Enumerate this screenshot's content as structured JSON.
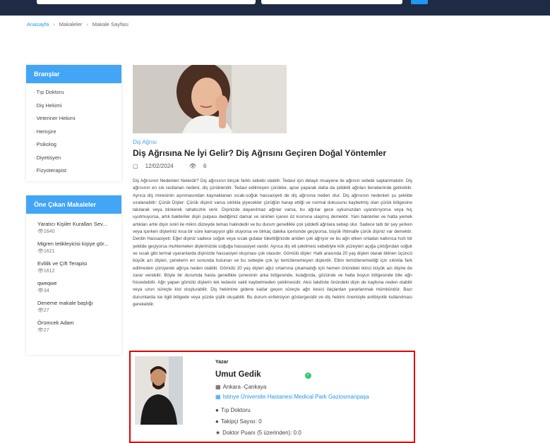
{
  "breadcrumb": {
    "home": "Anasayfa",
    "articles": "Makaleler",
    "current": "Makale Sayfası"
  },
  "branches": {
    "title": "Branşlar",
    "items": [
      "Tıp Doktoru",
      "Diş Hekimi",
      "Veteriner Hekimi",
      "Hemşire",
      "Psikolog",
      "Diyetisyen",
      "Fizyoterapist"
    ]
  },
  "featured": {
    "title": "Öne Çıkan Makaleler",
    "items": [
      {
        "title": "Yaratıcı Kişiler Kuralları Sev...",
        "views": "1640"
      },
      {
        "title": "Migren tetikleyicisi kişiye gör...",
        "views": "1621"
      },
      {
        "title": "Evlilik ve Çift Terapisi",
        "views": "1612"
      },
      {
        "title": "qweqwe",
        "views": "34"
      },
      {
        "title": "Deneme makale başlığı",
        "views": "27"
      },
      {
        "title": "Örümcek Adam",
        "views": "27"
      }
    ]
  },
  "article": {
    "category": "Diş Ağrısı",
    "title": "Diş Ağrısına Ne İyi Gelir? Diş Ağrısını Geçiren Doğal Yöntemler",
    "date": "12/02/2024",
    "views": "6",
    "body": "Diş Ağrısının Nedenleri Nelerdir? Diş ağrısının birçok farklı sebebi olabilir. Tedavi için detaylı muayene ile ağrının sebebi saptanmalıdır. Diş ağrısının en sık rastlanan nedeni, diş çürükleridir. Tedavi edilmeyen çürükler, apse yaparak daha da şiddetli ağrıları beraberinde getirebilir. Ayrıca diş minesinin aşınmasından kaynaklanan sıcak-soğuk hassasiyeti de diş ağrısına neden olur. Diş ağrısının nedenleri şu şekilde sıralanabilir: Çürük Dişler: Çürük dişiniz varsa sıklıkla yiyecekler çürüğün harap ettiği ve normal dokusunu kaybetmiş olan çürük bölgesine takılarak veya binkerek rahatsızlık verir. Dişinizde dayanılmaz ağrılar varsa, bu ağrılar gece uykunuzdan uyandırıyorsa veya hiç uyutmuyorsa, artık bakteriler dişin pulpası dediğimiz damar ve sinirleri içeren öz kısmına ulaşmış demektir. Yani bakteriler ve hatta yemek artıkları artık dişin siniri ile mikro düzeyde temas halindedir ve bu durum genellikle çok şiddetli ağrılara sebep olur. Sadece tatlı bir şey yerken veya içerken dişleriniz kısa bir süre kamaşıyor gibi oluyorsa ve birkaç dakika içerisinde geçiyorsa, büyük ihtimalle çürük dişiniz var demektir. Dentin Hassasiyeti: Eğer dişiniz sadece soğuk veya sıcak gıdalar tükettiğinizde aniden çok ağrıyor ve bu ağrı etken ortadan kalkınca hızlı bir şekilde geçiyorsa muhtemelen dişlerinizde soğuğa hassasiyet vardır. Ayrıca diş eti çekilmesi sebebiyle kök yüzeyleri açığa çıktığından soğuk ve sıcak gibi termal uyaranlarda dişinizde hassasiyet oluşması çok olasıdır. Gömülü dişler: Halk arasında 20 yaş dişleri olarak bilinen üçüncü büyük azı dişleri, çenelerin en sonunda bulunan ve bu sebeple çok iyi temizlenemeyen dişlerdir. Etkin temizlenemediği için sıklıkla fark edilmeden çürüyerek ağrıya neden olabilir. Gömülü 20 yaş dişleri ağız ortamına çıkamadığı için hemen önündeki ikinci büyük azı dişine de zarar verebilir. Böyle bir durumda hasta genellikle çenesinin arka bölgesinde, kulağında, gözünde ve hatta boyun bölgesinde bile ağrı hissedebilir. Ağrı yapan gömülü dişlerin tek tedavisi vakit kaybetmeden çekilmesidir. Aksi takdirde önündeki dişin de kaybına neden olabilir veya uzun süreçte kist oluşturabilir. Diş hekimine gidene kadar geçen süreçte ağrı kesici ilaçlardan yararlanmak mümkündür. Bazı durumlarda ise ilgili bölgede veya yüzde şişlik oluşabilir. Bu durum enfeksiyon göstergesidir ve diş hekimi önerisiyle antibiyotik kullanılması gerekebilir."
  },
  "author": {
    "label": "Yazar",
    "name": "Umut Gedik",
    "location": "Ankara -Çankaya",
    "hospital": "İstinye Üniversite Hastanesi Medical Park Gaziosmanpaşa",
    "specialty": "Tıp Doktoru",
    "followers": "Takipçi Sayısı: 0",
    "rating": "Doktor Puanı (5 üzerinden): 0.0"
  },
  "colors": {
    "accent": "#42a5f5",
    "link": "#2196f3",
    "navbar": "#1f2a44",
    "highlight_border": "#e00000"
  }
}
